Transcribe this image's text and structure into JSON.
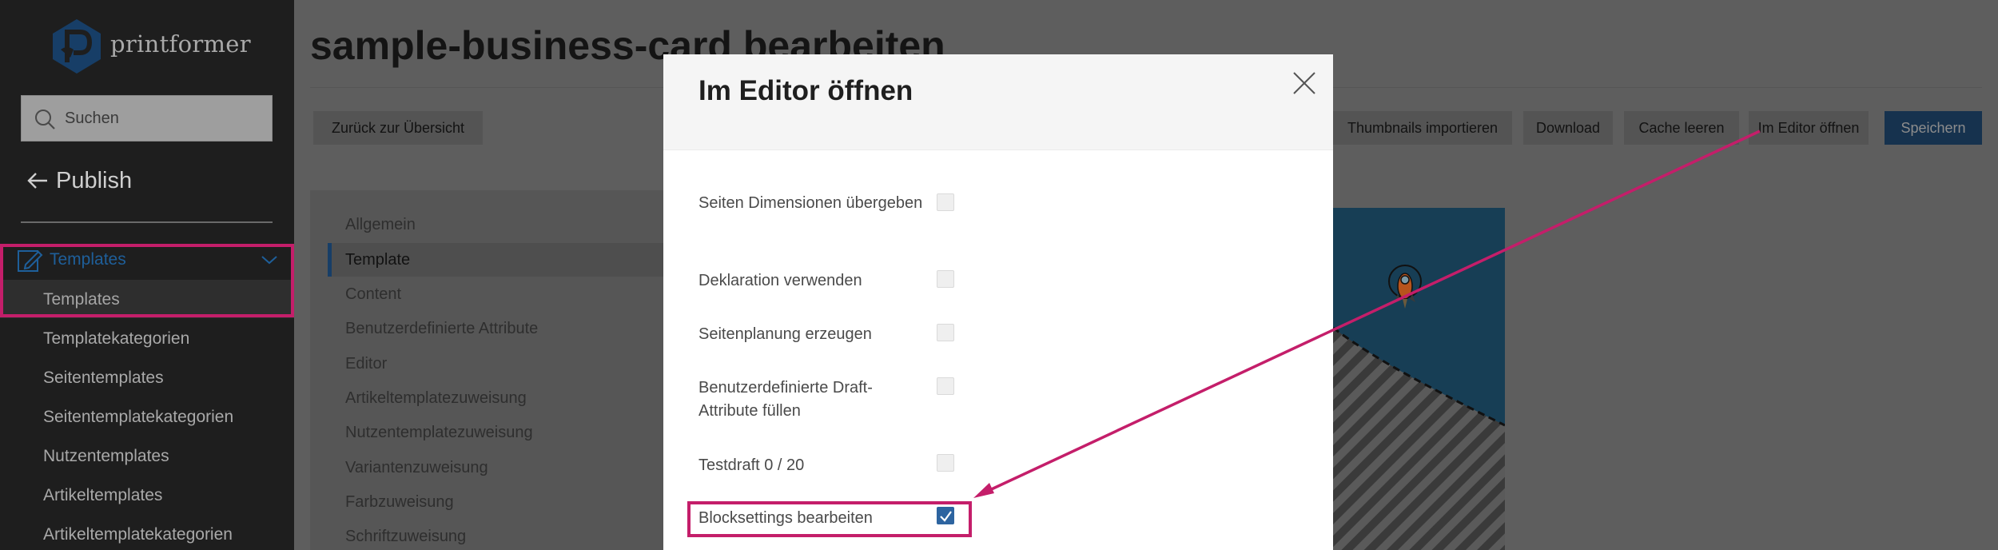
{
  "app": {
    "logo_text": "printformer",
    "brand_color": "#1e5f9a",
    "highlight_color": "#c41e6a"
  },
  "sidebar": {
    "search_placeholder": "Suchen",
    "back_label": "Publish",
    "group_label": "Templates",
    "active_sub_label": "Templates",
    "items": [
      "Templatekategorien",
      "Seitentemplates",
      "Seitentemplatekategorien",
      "Nutzentemplates",
      "Artikeltemplates",
      "Artikeltemplatekategorien"
    ]
  },
  "header": {
    "title": "sample-business-card bearbeiten"
  },
  "toolbar": {
    "back_overview": "Zurück zur Übersicht",
    "thumbnails_import": "Thumbnails importieren",
    "download": "Download",
    "clear_cache": "Cache leeren",
    "open_editor": "Im Editor öffnen",
    "save": "Speichern"
  },
  "tabs": [
    "Allgemein",
    "Template",
    "Content",
    "Benutzerdefinierte Attribute",
    "Editor",
    "Artikeltemplatezuweisung",
    "Nutzentemplatezuweisung",
    "Variantenzuweisung",
    "Farbzuweisung",
    "Schriftzuweisung"
  ],
  "active_tab": "Template",
  "modal": {
    "title": "Im Editor öffnen",
    "options": [
      {
        "label": "Seiten Dimensionen übergeben",
        "checked": false
      },
      {
        "label": "Deklaration verwenden",
        "checked": false
      },
      {
        "label": "Seitenplanung erzeugen",
        "checked": false
      },
      {
        "label": "Benutzerdefinierte Draft-Attribute füllen",
        "checked": false
      },
      {
        "label": "Testdraft 0 / 20",
        "checked": false
      },
      {
        "label": "Blocksettings bearbeiten",
        "checked": true
      }
    ]
  }
}
